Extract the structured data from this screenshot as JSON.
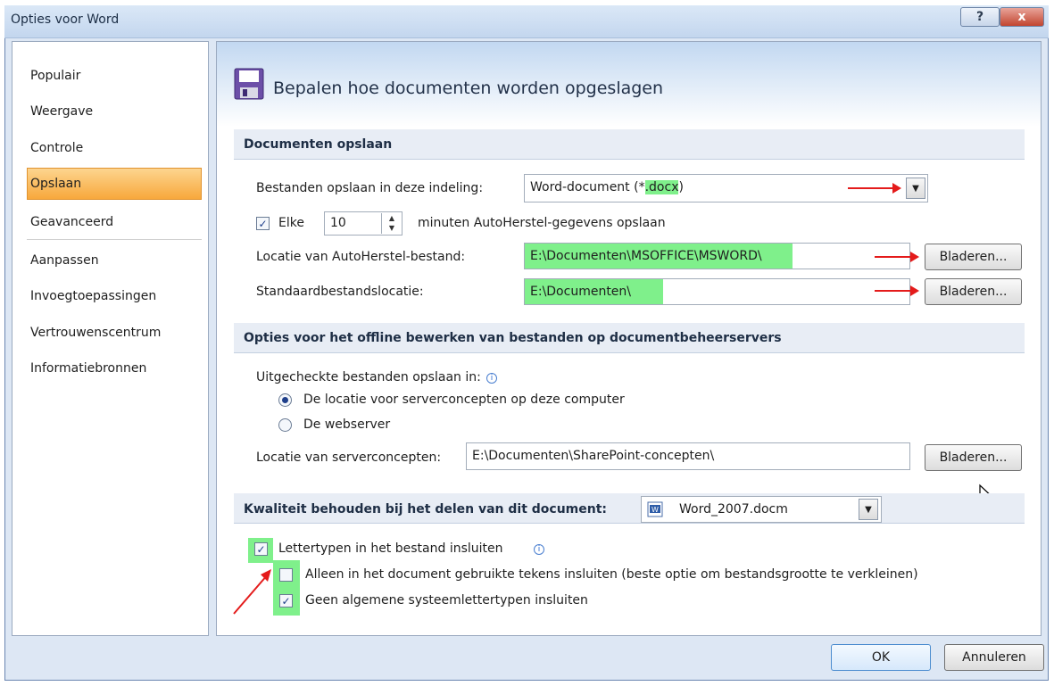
{
  "window": {
    "title": "Opties voor Word",
    "help_label": "?",
    "close_label": "x"
  },
  "sidebar": {
    "items": [
      {
        "label": "Populair"
      },
      {
        "label": "Weergave"
      },
      {
        "label": "Controle"
      },
      {
        "label": "Opslaan",
        "selected": true
      },
      {
        "label": "Geavanceerd"
      },
      {
        "label": "Aanpassen"
      },
      {
        "label": "Invoegtoepassingen"
      },
      {
        "label": "Vertrouwenscentrum"
      },
      {
        "label": "Informatiebronnen"
      }
    ]
  },
  "header": {
    "title": "Bepalen hoe documenten worden opgeslagen",
    "icon": "floppy-disk-icon"
  },
  "save_section": {
    "title": "Documenten opslaan",
    "format_label": "Bestanden opslaan in deze indeling:",
    "format_value_prefix": "Word-document (*",
    "format_value_highlight": ".docx",
    "format_value_suffix": ")",
    "autorecover_enabled": true,
    "autorecover_every_label": "Elke",
    "autorecover_minutes": "10",
    "autorecover_suffix": "minuten AutoHerstel-gegevens opslaan",
    "autorecover_location_label": "Locatie van AutoHerstel-bestand:",
    "autorecover_location_value": "E:\\Documenten\\MSOFFICE\\MSWORD\\",
    "default_location_label": "Standaardbestandslocatie:",
    "default_location_value": "E:\\Documenten\\",
    "browse_label": "Bladeren..."
  },
  "offline_section": {
    "title": "Opties voor het offline bewerken van bestanden op documentbeheerservers",
    "checked_out_label": "Uitgecheckte bestanden opslaan in:",
    "radio_local_label": "De locatie voor serverconcepten op deze computer",
    "radio_webserver_label": "De webserver",
    "selected_option": "local",
    "server_drafts_label": "Locatie van serverconcepten:",
    "server_drafts_value": "E:\\Documenten\\SharePoint-concepten\\",
    "browse_label": "Bladeren..."
  },
  "quality_section": {
    "title": "Kwaliteit behouden bij het delen van dit document:",
    "document_value": "Word_2007.docm",
    "embed_fonts_label": "Lettertypen in het bestand insluiten",
    "embed_fonts_checked": true,
    "only_used_chars_label": "Alleen in het document gebruikte tekens insluiten (beste optie om bestandsgrootte te verkleinen)",
    "only_used_chars_checked": false,
    "no_system_fonts_label": "Geen algemene systeemlettertypen insluiten",
    "no_system_fonts_checked": true
  },
  "footer": {
    "ok_label": "OK",
    "cancel_label": "Annuleren"
  },
  "colors": {
    "highlight": "#7ff08b",
    "annotation_arrow": "#e41b1b",
    "selected_sidebar": "#f7a83c"
  }
}
